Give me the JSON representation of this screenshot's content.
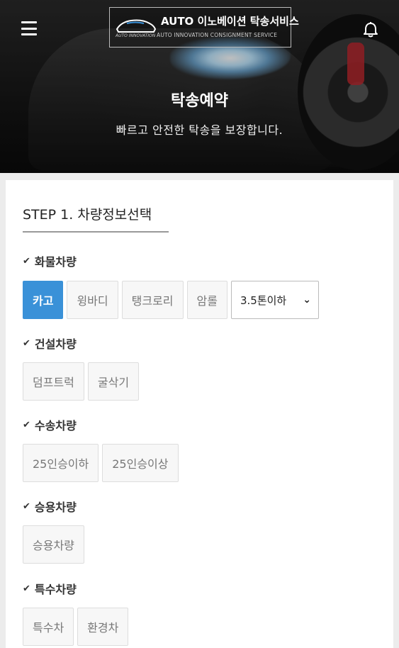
{
  "header": {
    "brand_main": "AUTO 이노베이션 탁송서비스",
    "brand_sub": "AUTO INNOVATION CONSIGNMENT SERVICE",
    "brand_small": "AUTO INNOVATION",
    "title": "탁송예약",
    "subtitle": "빠르고 안전한 탁송을 보장합니다."
  },
  "step": {
    "title": "STEP 1. 차량정보선택"
  },
  "sections": [
    {
      "label": "화물차량",
      "options": [
        "카고",
        "윙바디",
        "탱크로리",
        "암롤"
      ],
      "selected": "카고",
      "dropdown": "3.5톤이하"
    },
    {
      "label": "건설차량",
      "options": [
        "덤프트럭",
        "굴삭기"
      ]
    },
    {
      "label": "수송차량",
      "options": [
        "25인승이하",
        "25인승이상"
      ]
    },
    {
      "label": "승용차량",
      "options": [
        "승용차량"
      ]
    },
    {
      "label": "특수차량",
      "options": [
        "특수차",
        "환경차"
      ]
    }
  ],
  "colors": {
    "accent": "#3a91d8",
    "hero_dark": "#151515"
  },
  "icons": {
    "menu": "hamburger-icon",
    "bell": "bell-icon",
    "check": "check-icon",
    "chevron": "chevron-down-icon"
  }
}
